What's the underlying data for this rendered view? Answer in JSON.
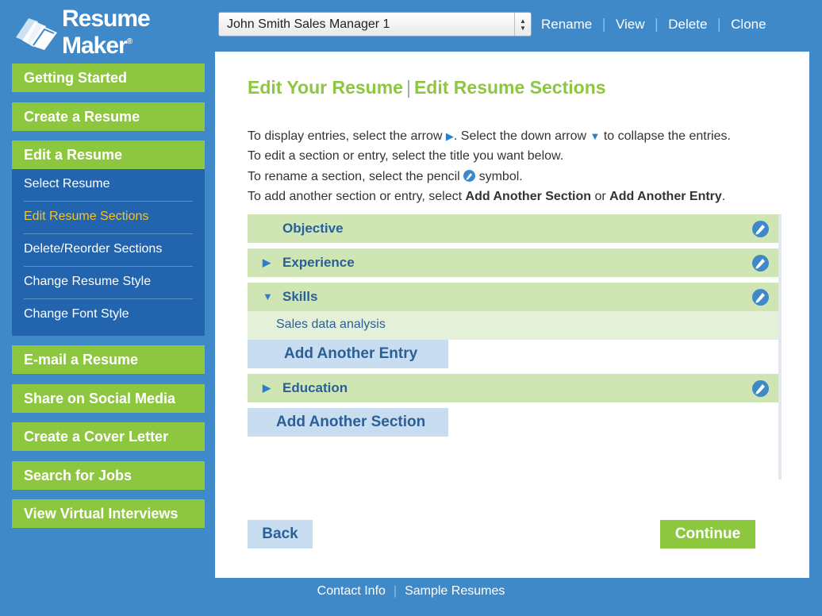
{
  "app": {
    "brand": "Resume Maker",
    "trademark": "®"
  },
  "resume_select": {
    "value": "John Smith Sales Manager 1"
  },
  "top_links": [
    "Rename",
    "View",
    "Delete",
    "Clone"
  ],
  "sidebar": {
    "top_items": [
      "Getting Started",
      "Create a Resume"
    ],
    "active_item": "Edit a Resume",
    "submenu": [
      "Select Resume",
      "Edit Resume Sections",
      "Delete/Reorder Sections",
      "Change Resume Style",
      "Change Font Style"
    ],
    "current_submenu": "Edit Resume Sections",
    "bottom_items": [
      "E-mail a Resume",
      "Share on Social Media",
      "Create a Cover Letter",
      "Search for Jobs",
      "View Virtual Interviews"
    ]
  },
  "main": {
    "title_part1": "Edit Your Resume",
    "title_sep": "|",
    "title_part2": "Edit Resume Sections",
    "instructions": {
      "line1_a": "To display entries, select the arrow ",
      "line1_b": ". Select the down arrow ",
      "line1_c": " to collapse the entries.",
      "line2": "To edit a section or entry, select the title you want below.",
      "line3_a": "To rename a section, select the pencil ",
      "line3_b": " symbol.",
      "line4_a": "To add another section or entry, select ",
      "line4_b": "Add Another Section",
      "line4_c": " or ",
      "line4_d": "Add Another Entry",
      "line4_e": "."
    },
    "sections": [
      {
        "label": "Objective",
        "caret": ""
      },
      {
        "label": "Experience",
        "caret": "▶"
      },
      {
        "label": "Skills",
        "caret": "▼"
      },
      {
        "label": "Education",
        "caret": "▶"
      }
    ],
    "skills_entry": "Sales data analysis",
    "add_entry_label": "Add Another Entry",
    "add_section_label": "Add Another Section",
    "back_label": "Back",
    "continue_label": "Continue"
  },
  "footer": {
    "links": [
      "Contact Info",
      "Sample Resumes"
    ]
  },
  "colors": {
    "background": "#3f89c9",
    "green": "#8dc63f",
    "submenu": "#2264ad",
    "highlight": "#f4c324"
  }
}
